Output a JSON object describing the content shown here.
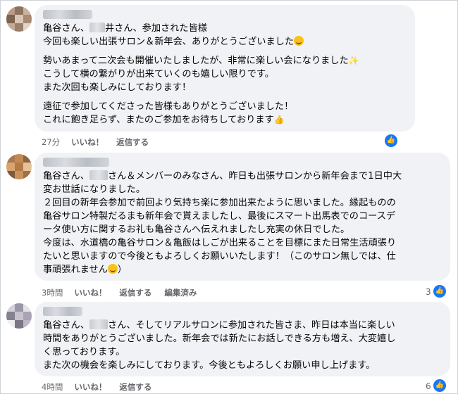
{
  "comments": [
    {
      "lines": [
        [
          "亀谷さん、",
          "",
          "井さん、参加された皆様"
        ],
        [
          "今回も楽しい出張サロン＆新年会、ありがとうございました"
        ],
        [],
        [
          "勢いあまって二次会も開催いたしましたが、非常に楽しい会になりました"
        ],
        [
          "こうして横の繋がりが出来ていくのも嬉しい限りです。"
        ],
        [
          "また次回も楽しみにしております！"
        ],
        [],
        [
          "遠征で参加してくださった皆様もありがとうございました！"
        ],
        [
          "これに飽き足らず、またのご参加をお待ちしております"
        ]
      ],
      "time": "27分",
      "like": "いいね！",
      "reply": "返信する",
      "edited": "",
      "reactions": ""
    },
    {
      "lines": [
        [
          "亀谷さん、",
          "",
          "さん＆メンバーのみなさん、昨日も出張サロンから新年会まで1日中大"
        ],
        [
          "変お世話になりました。"
        ],
        [
          "２回目の新年会参加で前回より気持ち楽に参加出来たように思いました。縁起ものの"
        ],
        [
          "亀谷サロン特製だるまも新年会で貰えましたし、最後にスマート出馬表でのコースデ"
        ],
        [
          "ータ使い方に関するお礼も亀谷さんへ伝えれましたし充実の休日でした。"
        ],
        [
          "今度は、水道橋の亀谷サロン＆亀飯はしごが出来ることを目標にまた日常生活頑張り"
        ],
        [
          "たいと思いますので今後ともよろしくお願いいたします！（このサロン無しでは、仕"
        ],
        [
          "事頑張れません"
        ]
      ],
      "last_line_tail": "）",
      "time": "3時間",
      "like": "いいね！",
      "reply": "返信する",
      "edited": "編集済み",
      "reactions": "3"
    },
    {
      "lines": [
        [
          "亀谷さん、",
          "",
          "さん、そしてリアルサロンに参加された皆さま、昨日は本当に楽しい"
        ],
        [
          "時間をありがとうございました。新年会では新たにお話しできる方も増え、大変嬉し"
        ],
        [
          "く思っております。"
        ],
        [
          "また次の機会を楽しみにしております。今後ともよろしくお願い申し上げます。"
        ]
      ],
      "time": "4時間",
      "like": "いいね！",
      "reply": "返信する",
      "edited": "",
      "reactions": "6"
    }
  ],
  "icons": {
    "like_reaction": "thumbs-up-icon",
    "smile": "smile-emoji-icon",
    "sparkles": "sparkles-emoji-icon",
    "thumb": "thumbs-up-emoji-icon"
  },
  "colors": {
    "bubble": "#f0f2f5",
    "secondary_text": "#65676b",
    "like_blue": "#1877f2"
  }
}
